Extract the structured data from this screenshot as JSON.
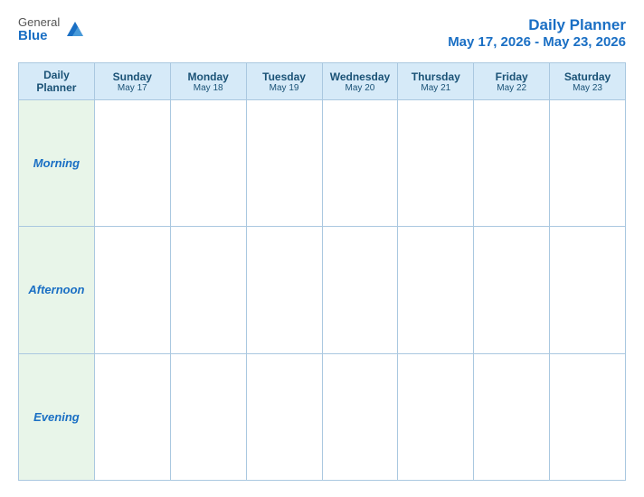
{
  "logo": {
    "general": "General",
    "blue": "Blue",
    "icon_color": "#1a6fc4"
  },
  "header": {
    "title": "Daily Planner",
    "date_range": "May 17, 2026 - May 23, 2026"
  },
  "table": {
    "label_col_header": "Daily\nPlanner",
    "days": [
      {
        "name": "Sunday",
        "date": "May 17"
      },
      {
        "name": "Monday",
        "date": "May 18"
      },
      {
        "name": "Tuesday",
        "date": "May 19"
      },
      {
        "name": "Wednesday",
        "date": "May 20"
      },
      {
        "name": "Thursday",
        "date": "May 21"
      },
      {
        "name": "Friday",
        "date": "May 22"
      },
      {
        "name": "Saturday",
        "date": "May 23"
      }
    ],
    "rows": [
      {
        "label": "Morning"
      },
      {
        "label": "Afternoon"
      },
      {
        "label": "Evening"
      }
    ]
  }
}
